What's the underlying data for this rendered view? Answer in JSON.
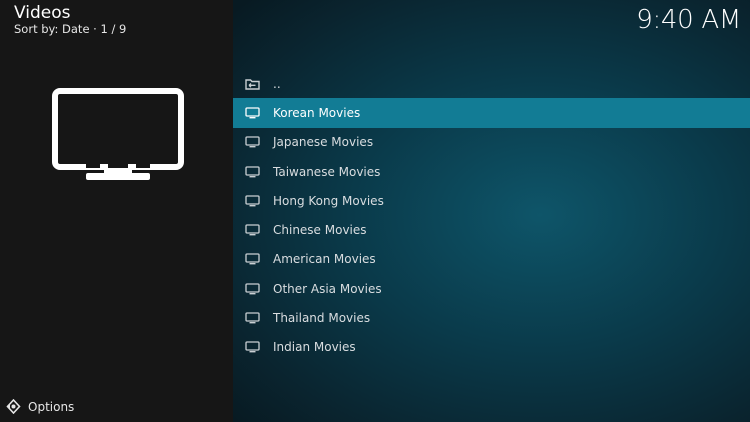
{
  "header": {
    "title": "Videos",
    "subtitle": "Sort by: Date · 1 / 9"
  },
  "clock": "9:40 AM",
  "list": {
    "parent_label": "..",
    "items": [
      {
        "label": "Korean Movies",
        "icon": "tv-icon",
        "selected": true
      },
      {
        "label": "Japanese Movies",
        "icon": "tv-icon",
        "selected": false
      },
      {
        "label": "Taiwanese Movies",
        "icon": "tv-icon",
        "selected": false
      },
      {
        "label": "Hong Kong Movies",
        "icon": "tv-icon",
        "selected": false
      },
      {
        "label": "Chinese Movies",
        "icon": "tv-icon",
        "selected": false
      },
      {
        "label": "American Movies",
        "icon": "tv-icon",
        "selected": false
      },
      {
        "label": "Other Asia Movies",
        "icon": "tv-icon",
        "selected": false
      },
      {
        "label": "Thailand Movies",
        "icon": "tv-icon",
        "selected": false
      },
      {
        "label": "Indian Movies",
        "icon": "tv-icon",
        "selected": false
      }
    ]
  },
  "footer": {
    "options_label": "Options"
  },
  "colors": {
    "highlight": "#127c95",
    "left_panel": "#161616",
    "background": "#0a3a4a"
  }
}
